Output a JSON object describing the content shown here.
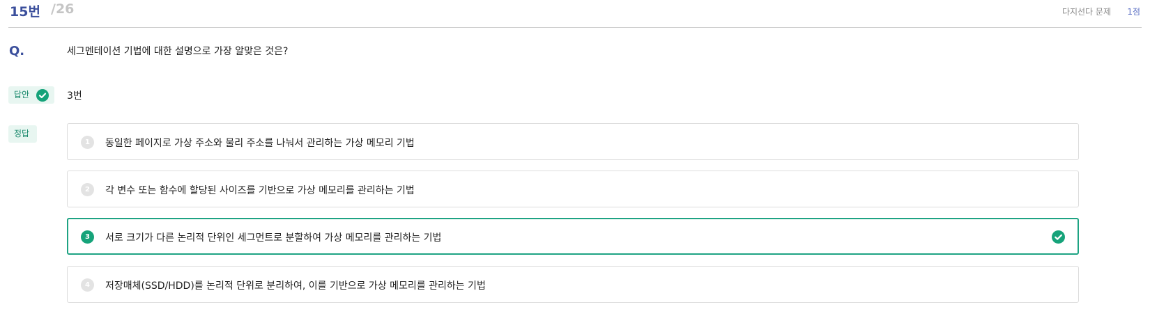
{
  "header": {
    "number": "15번",
    "total": "/26",
    "type": "다지선다 문제",
    "points": "1점"
  },
  "question": {
    "mark": "Q.",
    "text": "세그멘테이션 기법에 대한 설명으로 가장 알맞은 것은?"
  },
  "answer": {
    "tag_label": "답안",
    "value": "3번"
  },
  "correct": {
    "tag_label": "정답"
  },
  "choices": [
    {
      "number": "1",
      "text": "동일한 페이지로 가상 주소와 물리 주소를 나눠서 관리하는 가상 메모리 기법"
    },
    {
      "number": "2",
      "text": "각 변수 또는 함수에 할당된 사이즈를 기반으로 가상 메모리를 관리하는 기법"
    },
    {
      "number": "3",
      "text": "서로 크기가 다른 논리적 단위인 세그먼트로 분할하여 가상 메모리를 관리하는 기법"
    },
    {
      "number": "4",
      "text": "저장매체(SSD/HDD)를 논리적 단위로 분리하여, 이를 기반으로 가상 메모리를 관리하는 기법"
    }
  ],
  "colors": {
    "accent_blue": "#3b4f9c",
    "correct_green": "#16a37a",
    "tag_bg": "#e8f6f1"
  },
  "icons": {
    "answer_tag_icon": "check-circle-icon",
    "correct_choice_icon": "check-circle-icon"
  }
}
